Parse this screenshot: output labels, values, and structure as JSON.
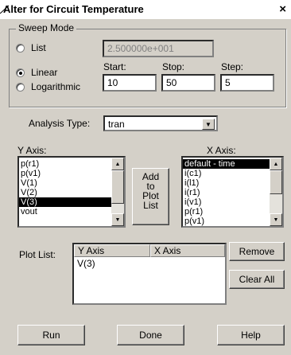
{
  "window": {
    "title": "Alter for Circuit Temperature",
    "close": "×"
  },
  "sweep": {
    "group_label": "Sweep Mode",
    "list_label": "List",
    "list_value": "2.500000e+001",
    "linear_label": "Linear",
    "log_label": "Logarithmic",
    "start_label": "Start:",
    "stop_label": "Stop:",
    "step_label": "Step:",
    "start_value": "10",
    "stop_value": "50",
    "step_value": "5",
    "selected": "Linear"
  },
  "analysis": {
    "label": "Analysis Type:",
    "value": "tran"
  },
  "y_axis": {
    "label": "Y Axis:",
    "items": [
      "p(r1)",
      "p(v1)",
      "V(1)",
      "V(2)",
      "V(3)",
      "vout"
    ],
    "selected_item": "V(3)"
  },
  "add_button": {
    "line1": "Add",
    "line2": "to",
    "line3": "Plot",
    "line4": "List"
  },
  "x_axis": {
    "label": "X Axis:",
    "items": [
      "default - time",
      "i(c1)",
      "i(l1)",
      "i(r1)",
      "i(v1)",
      "p(r1)",
      "p(v1)"
    ],
    "selected_item": "default - time"
  },
  "plot_list": {
    "label": "Plot List:",
    "col_y": "Y Axis",
    "col_x": "X Axis",
    "rows": [
      {
        "y": "V(3)",
        "x": ""
      }
    ]
  },
  "side_buttons": {
    "remove": "Remove",
    "clear_all": "Clear All"
  },
  "footer": {
    "run": "Run",
    "done": "Done",
    "help": "Help"
  }
}
